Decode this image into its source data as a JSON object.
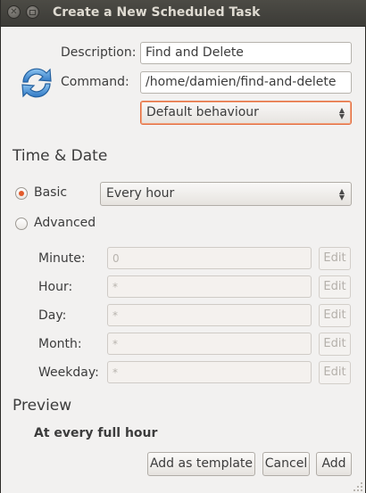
{
  "window": {
    "title": "Create a New Scheduled Task"
  },
  "icon": {
    "name": "refresh-icon"
  },
  "form": {
    "description_label": "Description:",
    "description_value": "Find and Delete",
    "command_label": "Command:",
    "command_value": "/home/damien/find-and-delete",
    "behaviour_value": "Default behaviour"
  },
  "time_date": {
    "heading": "Time & Date",
    "basic_label": "Basic",
    "basic_value": "Every hour",
    "advanced_label": "Advanced",
    "fields": [
      {
        "label": "Minute:",
        "value": "0",
        "button": "Edit"
      },
      {
        "label": "Hour:",
        "value": "*",
        "button": "Edit"
      },
      {
        "label": "Day:",
        "value": "*",
        "button": "Edit"
      },
      {
        "label": "Month:",
        "value": "*",
        "button": "Edit"
      },
      {
        "label": "Weekday:",
        "value": "*",
        "button": "Edit"
      }
    ]
  },
  "preview": {
    "heading": "Preview",
    "text": "At every full hour"
  },
  "buttons": {
    "add_template": "Add as template",
    "cancel": "Cancel",
    "add": "Add"
  },
  "colors": {
    "accent": "#e25a2b",
    "titlebar": "#3c3b37",
    "window_bg": "#f2f1f0"
  }
}
